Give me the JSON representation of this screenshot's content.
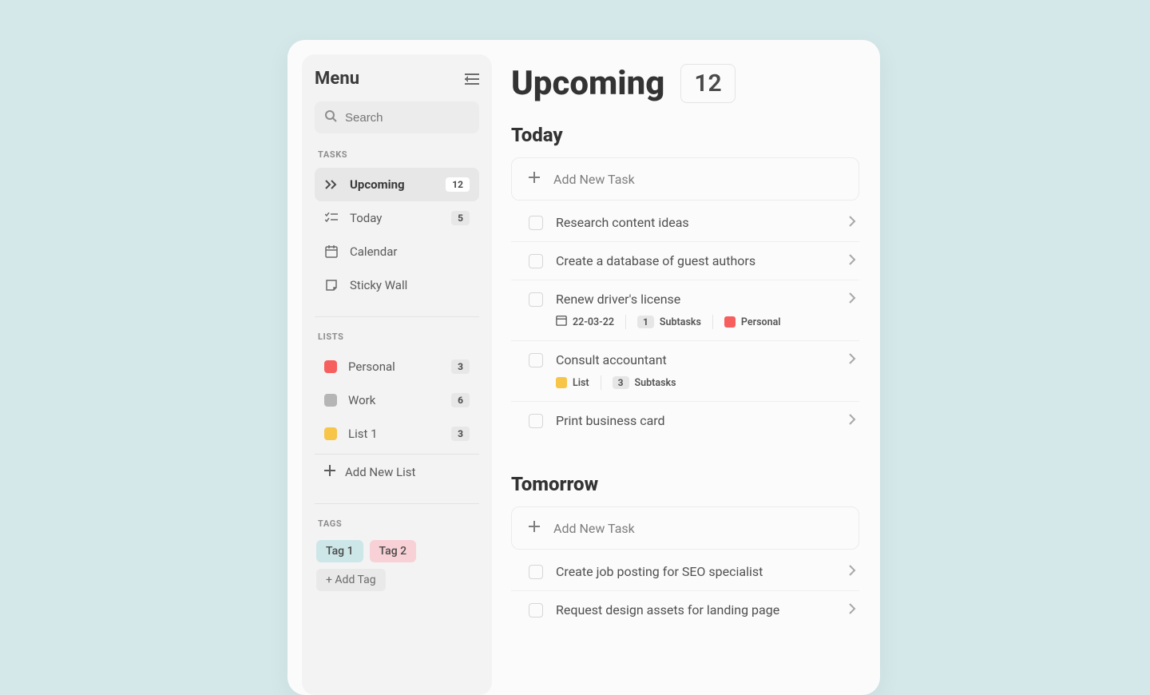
{
  "sidebar": {
    "title": "Menu",
    "search_placeholder": "Search",
    "sections": {
      "tasks_label": "TASKS",
      "lists_label": "LISTS",
      "tags_label": "TAGS"
    },
    "nav": {
      "upcoming": {
        "label": "Upcoming",
        "count": "12"
      },
      "today": {
        "label": "Today",
        "count": "5"
      },
      "calendar": {
        "label": "Calendar"
      },
      "sticky": {
        "label": "Sticky Wall"
      }
    },
    "lists": [
      {
        "label": "Personal",
        "count": "3",
        "color": "#f75f5f"
      },
      {
        "label": "Work",
        "count": "6",
        "color": "#b5b5b5"
      },
      {
        "label": "List 1",
        "count": "3",
        "color": "#f7c548"
      }
    ],
    "add_list_label": "Add New List",
    "tags": [
      {
        "label": "Tag 1",
        "bg": "#cde7e9"
      },
      {
        "label": "Tag 2",
        "bg": "#f7d1d6"
      }
    ],
    "add_tag_label": "+ Add Tag"
  },
  "main": {
    "title": "Upcoming",
    "count": "12",
    "sections": [
      {
        "heading": "Today",
        "add_label": "Add New Task",
        "tasks": [
          {
            "title": "Research content ideas"
          },
          {
            "title": "Create a database of guest authors"
          },
          {
            "title": "Renew driver's license",
            "date": "22-03-22",
            "subtasks_count": "1",
            "subtasks_label": "Subtasks",
            "tag_label": "Personal",
            "tag_color": "#f75f5f"
          },
          {
            "title": "Consult accountant",
            "tag_label": "List",
            "tag_color": "#f7c548",
            "subtasks_count": "3",
            "subtasks_label": "Subtasks"
          },
          {
            "title": "Print business card"
          }
        ]
      },
      {
        "heading": "Tomorrow",
        "add_label": "Add New Task",
        "tasks": [
          {
            "title": "Create job posting for SEO specialist"
          },
          {
            "title": "Request design assets for landing page"
          }
        ]
      }
    ]
  }
}
